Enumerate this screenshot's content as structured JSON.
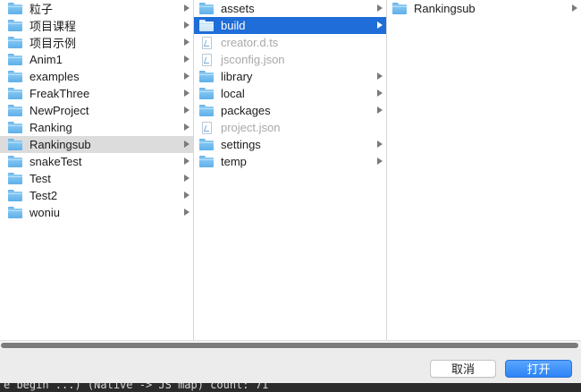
{
  "column1": {
    "items": [
      {
        "label": "粒子"
      },
      {
        "label": "项目课程"
      },
      {
        "label": "项目示例"
      },
      {
        "label": "Anim1"
      },
      {
        "label": "examples"
      },
      {
        "label": "FreakThree"
      },
      {
        "label": "NewProject"
      },
      {
        "label": "Ranking"
      },
      {
        "label": "Rankingsub"
      },
      {
        "label": "snakeTest"
      },
      {
        "label": "Test"
      },
      {
        "label": "Test2"
      },
      {
        "label": "woniu"
      }
    ]
  },
  "column2": {
    "items": [
      {
        "label": "assets"
      },
      {
        "label": "build"
      },
      {
        "label": "creator.d.ts"
      },
      {
        "label": "jsconfig.json"
      },
      {
        "label": "library"
      },
      {
        "label": "local"
      },
      {
        "label": "packages"
      },
      {
        "label": "project.json"
      },
      {
        "label": "settings"
      },
      {
        "label": "temp"
      }
    ]
  },
  "column3": {
    "items": [
      {
        "label": "Rankingsub"
      }
    ]
  },
  "buttons": {
    "cancel": "取消",
    "open": "打开"
  },
  "terminal": {
    "text": "e begin ...) (Native -> JS map) count: 71"
  },
  "colors": {
    "selection_blue": "#1e6dd8",
    "selection_grey": "#dcdcdc",
    "folder": "#5fb0ea",
    "primary_button": "#2d84f5"
  }
}
